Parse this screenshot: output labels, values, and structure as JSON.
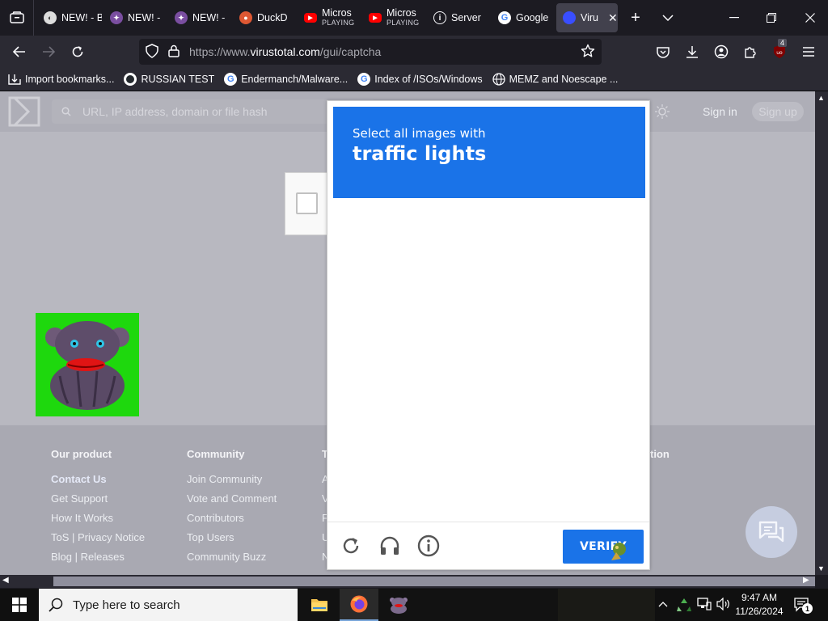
{
  "browser": {
    "tabs": [
      {
        "title": "NEW! - Bor",
        "icon": "globe-icon",
        "active": false
      },
      {
        "title": "NEW! -",
        "icon": "sparkle-icon",
        "active": false
      },
      {
        "title": "NEW! -",
        "icon": "sparkle-icon",
        "active": false
      },
      {
        "title": "DuckD",
        "icon": "duckduckgo-icon",
        "active": false
      },
      {
        "title": "Micros",
        "sub": "PLAYING",
        "icon": "youtube-icon",
        "active": false
      },
      {
        "title": "Micros",
        "sub": "PLAYING",
        "icon": "youtube-icon",
        "active": false
      },
      {
        "title": "Server",
        "icon": "info-icon",
        "active": false
      },
      {
        "title": "Google",
        "icon": "google-icon",
        "active": false
      },
      {
        "title": "Viru",
        "icon": "virustotal-icon",
        "active": true
      }
    ],
    "url_prefix": "https://www.",
    "url_domain": "virustotal.com",
    "url_path": "/gui/captcha",
    "extension_badge": "4",
    "bookmarks": [
      {
        "label": "Import bookmarks...",
        "icon": "import-icon"
      },
      {
        "label": "RUSSIAN TEST",
        "icon": "octocat-icon"
      },
      {
        "label": "Endermanch/Malware...",
        "icon": "google-icon"
      },
      {
        "label": "Index of /ISOs/Windows",
        "icon": "google-icon"
      },
      {
        "label": "MEMZ and Noescape ...",
        "icon": "globe-icon"
      }
    ]
  },
  "page": {
    "search_placeholder": "URL, IP address, domain or file hash",
    "sign_in": "Sign in",
    "sign_up": "Sign up",
    "footer": {
      "col1": {
        "heading": "Our product",
        "links": [
          "Contact Us",
          "Get Support",
          "How It Works",
          "ToS | Privacy Notice",
          "Blog | Releases"
        ]
      },
      "col2": {
        "heading": "Community",
        "links": [
          "Join Community",
          "Vote and Comment",
          "Contributors",
          "Top Users",
          "Community Buzz"
        ]
      },
      "col3_partial": {
        "heading": "T",
        "links": [
          "A",
          "V",
          "F",
          "U",
          "N"
        ]
      },
      "col4_partial_heading": "tion"
    }
  },
  "captcha": {
    "instruction": "Select all images with",
    "target": "traffic lights",
    "verify_label": "VERIFY"
  },
  "taskbar": {
    "search_placeholder": "Type here to search",
    "time": "9:47 AM",
    "date": "11/26/2024",
    "notification_count": "1"
  },
  "colors": {
    "captcha_blue": "#1a73e8",
    "page_overlay": "#b8b8c0",
    "sticker_green": "#1ed80d"
  }
}
